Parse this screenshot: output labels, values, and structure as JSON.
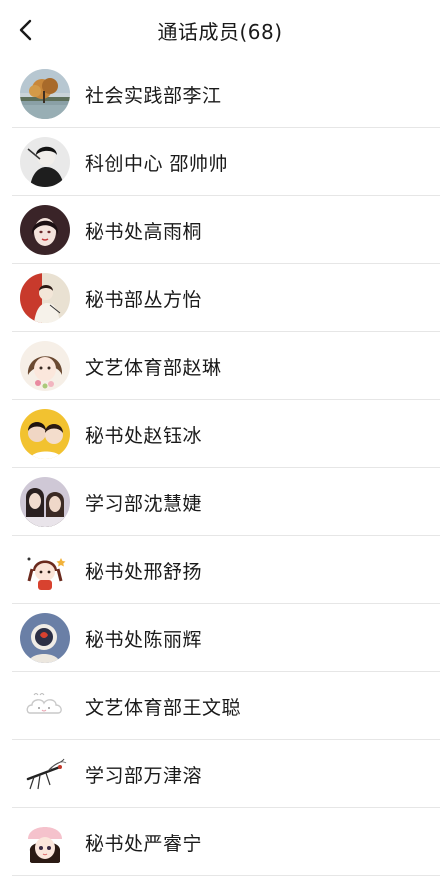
{
  "header": {
    "title": "通话成员(68)",
    "back_icon": "chevron-left-icon"
  },
  "members": [
    {
      "name": "社会实践部李江"
    },
    {
      "name": "科创中心 邵帅帅"
    },
    {
      "name": "秘书处高雨桐"
    },
    {
      "name": "秘书部丛方怡"
    },
    {
      "name": "文艺体育部赵琳"
    },
    {
      "name": "秘书处赵钰冰"
    },
    {
      "name": "学习部沈慧婕"
    },
    {
      "name": "秘书处邢舒扬"
    },
    {
      "name": "秘书处陈丽辉"
    },
    {
      "name": "文艺体育部王文聪"
    },
    {
      "name": "学习部万津溶"
    },
    {
      "name": "秘书处严睿宁"
    }
  ],
  "colors": {
    "divider": "#e6e6e6",
    "text": "#1a1a1a",
    "background": "#ffffff"
  }
}
